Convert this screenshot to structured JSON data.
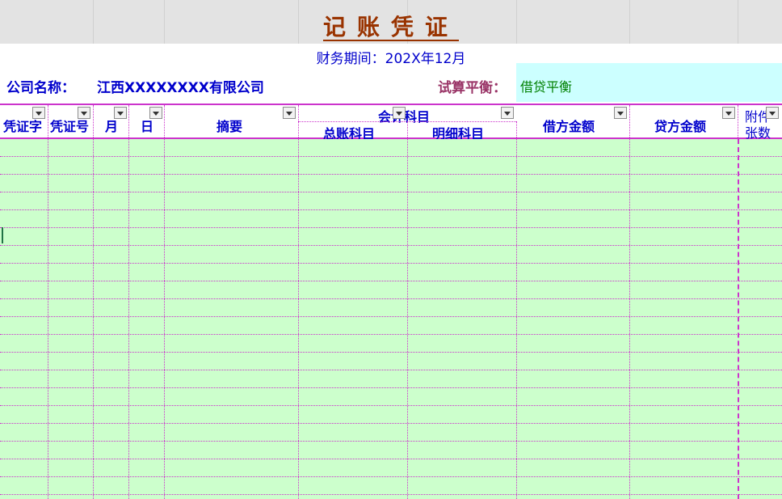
{
  "voucher": {
    "title": "记账凭证",
    "period": "财务期间：202X年12月",
    "company_label": "公司名称：",
    "company_name": "江西XXXXXXXX有限公司",
    "balance_label": "试算平衡：",
    "balance_value": "借贷平衡"
  },
  "table": {
    "columns": [
      {
        "key": "voucher_type",
        "label": "凭证字"
      },
      {
        "key": "voucher_no",
        "label": "凭证号"
      },
      {
        "key": "month",
        "label": "月"
      },
      {
        "key": "day",
        "label": "日"
      },
      {
        "key": "summary",
        "label": "摘要"
      },
      {
        "key": "account_group",
        "label": "会计科目"
      },
      {
        "key": "debit",
        "label": "借方金额"
      },
      {
        "key": "credit",
        "label": "贷方金额"
      },
      {
        "key": "attachments",
        "label": "附件张数"
      }
    ],
    "account_subcolumns": [
      "总账科目",
      "明细科目"
    ],
    "attachments_label": [
      "附件",
      "张数"
    ]
  },
  "colors": {
    "title": "#993300",
    "header_text": "#0000cc",
    "border": "#cc33cc",
    "row_fill": "#ccffcc",
    "balance_fill": "#ccffff",
    "balance_text": "#008000"
  }
}
